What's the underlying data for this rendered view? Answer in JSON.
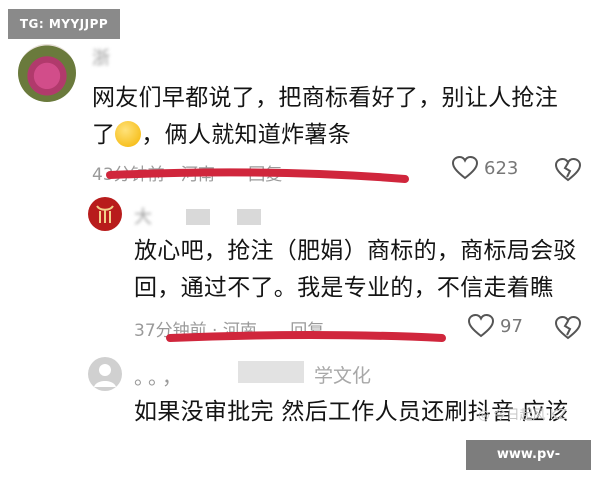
{
  "watermark_top": "TG: MYYJJPP",
  "watermark_bottom": "www.pv-add.com",
  "faint_watermark": "◎ 今日起风·KZ",
  "comments": [
    {
      "name": "浙",
      "text_line1": "网友们早都说了，把商标看好了，别让人抢注",
      "text_line2_prefix": "了",
      "text_line2_suffix": "，俩人就知道炸薯条",
      "time_loc": "43分钟前 · 河南",
      "reply_label": "回复",
      "likes": "623"
    },
    {
      "name": "大",
      "text_line1": "放心吧，抢注（肥娟）商标的，商标局会驳",
      "text_line2": "回，通过不了。我是专业的，不信走着瞧",
      "time_loc": "37分钟前 · 河南",
      "reply_label": "回复",
      "likes": "97"
    },
    {
      "name": "。。，",
      "name_suffix": "学文化",
      "text_line1": "如果没审批完 然后工作人员还刷抖音 应该"
    }
  ],
  "colors": {
    "underline": "#d0263c",
    "meta_gray": "#9a9a9a"
  },
  "icons": [
    "heart-icon",
    "broken-heart-icon",
    "emoji-icon"
  ]
}
